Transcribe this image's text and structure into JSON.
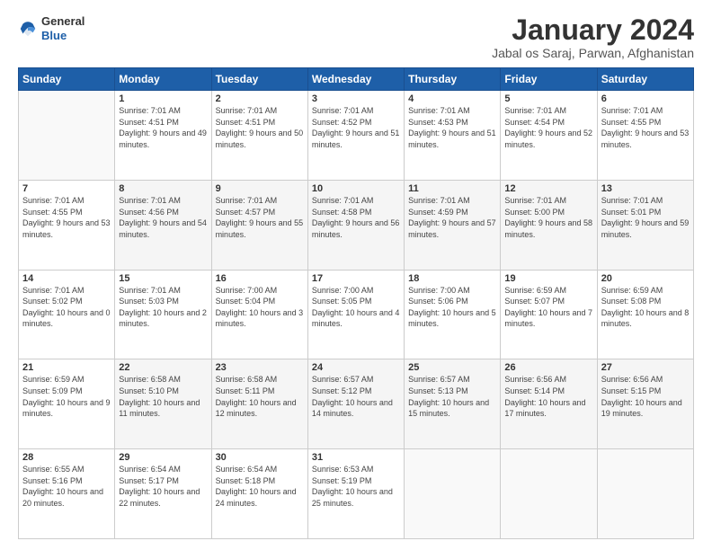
{
  "logo": {
    "general": "General",
    "blue": "Blue"
  },
  "title": "January 2024",
  "subtitle": "Jabal os Saraj, Parwan, Afghanistan",
  "weekdays": [
    "Sunday",
    "Monday",
    "Tuesday",
    "Wednesday",
    "Thursday",
    "Friday",
    "Saturday"
  ],
  "weeks": [
    [
      {
        "day": "",
        "sunrise": "",
        "sunset": "",
        "daylight": ""
      },
      {
        "day": "1",
        "sunrise": "Sunrise: 7:01 AM",
        "sunset": "Sunset: 4:51 PM",
        "daylight": "Daylight: 9 hours and 49 minutes."
      },
      {
        "day": "2",
        "sunrise": "Sunrise: 7:01 AM",
        "sunset": "Sunset: 4:51 PM",
        "daylight": "Daylight: 9 hours and 50 minutes."
      },
      {
        "day": "3",
        "sunrise": "Sunrise: 7:01 AM",
        "sunset": "Sunset: 4:52 PM",
        "daylight": "Daylight: 9 hours and 51 minutes."
      },
      {
        "day": "4",
        "sunrise": "Sunrise: 7:01 AM",
        "sunset": "Sunset: 4:53 PM",
        "daylight": "Daylight: 9 hours and 51 minutes."
      },
      {
        "day": "5",
        "sunrise": "Sunrise: 7:01 AM",
        "sunset": "Sunset: 4:54 PM",
        "daylight": "Daylight: 9 hours and 52 minutes."
      },
      {
        "day": "6",
        "sunrise": "Sunrise: 7:01 AM",
        "sunset": "Sunset: 4:55 PM",
        "daylight": "Daylight: 9 hours and 53 minutes."
      }
    ],
    [
      {
        "day": "7",
        "sunrise": "Sunrise: 7:01 AM",
        "sunset": "Sunset: 4:55 PM",
        "daylight": "Daylight: 9 hours and 53 minutes."
      },
      {
        "day": "8",
        "sunrise": "Sunrise: 7:01 AM",
        "sunset": "Sunset: 4:56 PM",
        "daylight": "Daylight: 9 hours and 54 minutes."
      },
      {
        "day": "9",
        "sunrise": "Sunrise: 7:01 AM",
        "sunset": "Sunset: 4:57 PM",
        "daylight": "Daylight: 9 hours and 55 minutes."
      },
      {
        "day": "10",
        "sunrise": "Sunrise: 7:01 AM",
        "sunset": "Sunset: 4:58 PM",
        "daylight": "Daylight: 9 hours and 56 minutes."
      },
      {
        "day": "11",
        "sunrise": "Sunrise: 7:01 AM",
        "sunset": "Sunset: 4:59 PM",
        "daylight": "Daylight: 9 hours and 57 minutes."
      },
      {
        "day": "12",
        "sunrise": "Sunrise: 7:01 AM",
        "sunset": "Sunset: 5:00 PM",
        "daylight": "Daylight: 9 hours and 58 minutes."
      },
      {
        "day": "13",
        "sunrise": "Sunrise: 7:01 AM",
        "sunset": "Sunset: 5:01 PM",
        "daylight": "Daylight: 9 hours and 59 minutes."
      }
    ],
    [
      {
        "day": "14",
        "sunrise": "Sunrise: 7:01 AM",
        "sunset": "Sunset: 5:02 PM",
        "daylight": "Daylight: 10 hours and 0 minutes."
      },
      {
        "day": "15",
        "sunrise": "Sunrise: 7:01 AM",
        "sunset": "Sunset: 5:03 PM",
        "daylight": "Daylight: 10 hours and 2 minutes."
      },
      {
        "day": "16",
        "sunrise": "Sunrise: 7:00 AM",
        "sunset": "Sunset: 5:04 PM",
        "daylight": "Daylight: 10 hours and 3 minutes."
      },
      {
        "day": "17",
        "sunrise": "Sunrise: 7:00 AM",
        "sunset": "Sunset: 5:05 PM",
        "daylight": "Daylight: 10 hours and 4 minutes."
      },
      {
        "day": "18",
        "sunrise": "Sunrise: 7:00 AM",
        "sunset": "Sunset: 5:06 PM",
        "daylight": "Daylight: 10 hours and 5 minutes."
      },
      {
        "day": "19",
        "sunrise": "Sunrise: 6:59 AM",
        "sunset": "Sunset: 5:07 PM",
        "daylight": "Daylight: 10 hours and 7 minutes."
      },
      {
        "day": "20",
        "sunrise": "Sunrise: 6:59 AM",
        "sunset": "Sunset: 5:08 PM",
        "daylight": "Daylight: 10 hours and 8 minutes."
      }
    ],
    [
      {
        "day": "21",
        "sunrise": "Sunrise: 6:59 AM",
        "sunset": "Sunset: 5:09 PM",
        "daylight": "Daylight: 10 hours and 9 minutes."
      },
      {
        "day": "22",
        "sunrise": "Sunrise: 6:58 AM",
        "sunset": "Sunset: 5:10 PM",
        "daylight": "Daylight: 10 hours and 11 minutes."
      },
      {
        "day": "23",
        "sunrise": "Sunrise: 6:58 AM",
        "sunset": "Sunset: 5:11 PM",
        "daylight": "Daylight: 10 hours and 12 minutes."
      },
      {
        "day": "24",
        "sunrise": "Sunrise: 6:57 AM",
        "sunset": "Sunset: 5:12 PM",
        "daylight": "Daylight: 10 hours and 14 minutes."
      },
      {
        "day": "25",
        "sunrise": "Sunrise: 6:57 AM",
        "sunset": "Sunset: 5:13 PM",
        "daylight": "Daylight: 10 hours and 15 minutes."
      },
      {
        "day": "26",
        "sunrise": "Sunrise: 6:56 AM",
        "sunset": "Sunset: 5:14 PM",
        "daylight": "Daylight: 10 hours and 17 minutes."
      },
      {
        "day": "27",
        "sunrise": "Sunrise: 6:56 AM",
        "sunset": "Sunset: 5:15 PM",
        "daylight": "Daylight: 10 hours and 19 minutes."
      }
    ],
    [
      {
        "day": "28",
        "sunrise": "Sunrise: 6:55 AM",
        "sunset": "Sunset: 5:16 PM",
        "daylight": "Daylight: 10 hours and 20 minutes."
      },
      {
        "day": "29",
        "sunrise": "Sunrise: 6:54 AM",
        "sunset": "Sunset: 5:17 PM",
        "daylight": "Daylight: 10 hours and 22 minutes."
      },
      {
        "day": "30",
        "sunrise": "Sunrise: 6:54 AM",
        "sunset": "Sunset: 5:18 PM",
        "daylight": "Daylight: 10 hours and 24 minutes."
      },
      {
        "day": "31",
        "sunrise": "Sunrise: 6:53 AM",
        "sunset": "Sunset: 5:19 PM",
        "daylight": "Daylight: 10 hours and 25 minutes."
      },
      {
        "day": "",
        "sunrise": "",
        "sunset": "",
        "daylight": ""
      },
      {
        "day": "",
        "sunrise": "",
        "sunset": "",
        "daylight": ""
      },
      {
        "day": "",
        "sunrise": "",
        "sunset": "",
        "daylight": ""
      }
    ]
  ]
}
